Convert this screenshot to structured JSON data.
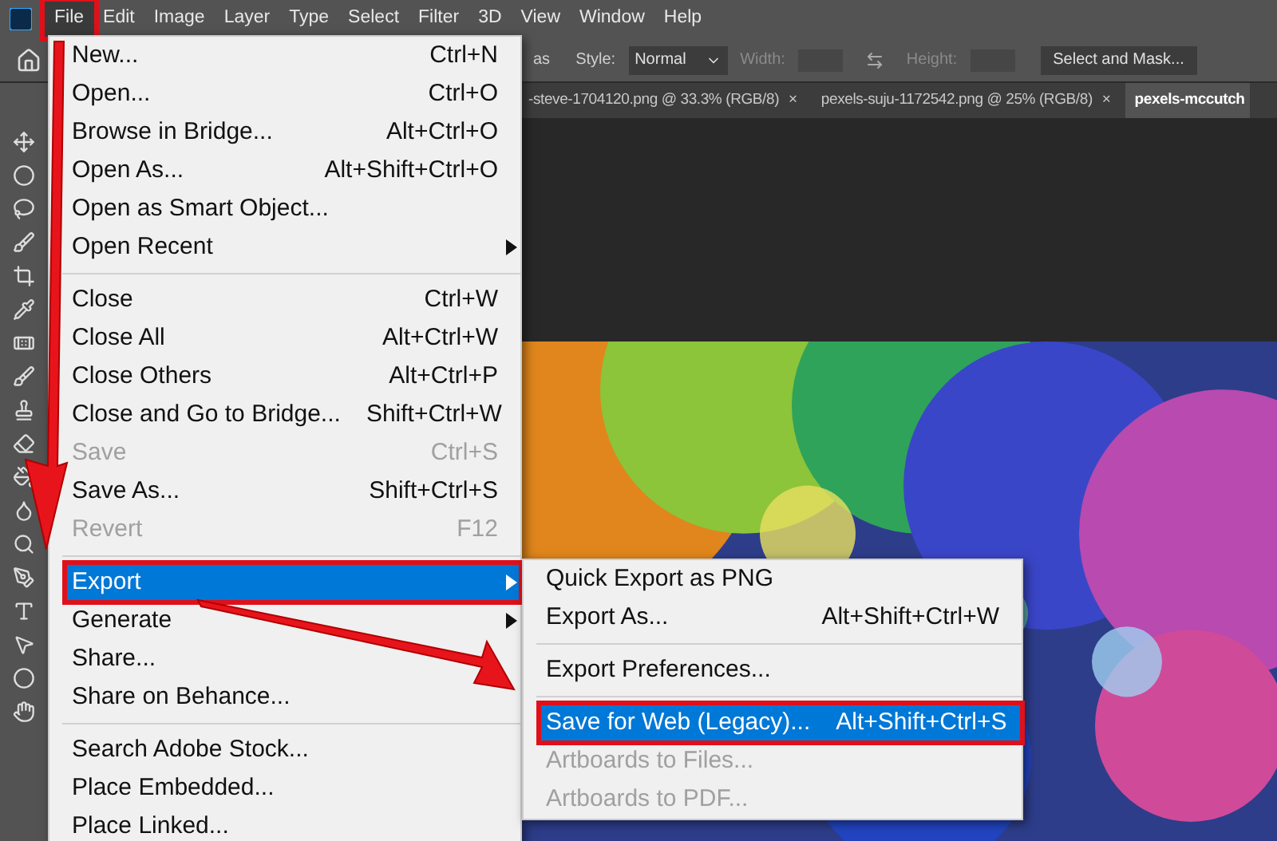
{
  "menubar": [
    {
      "label": "File",
      "selected": true,
      "outlined": true
    },
    {
      "label": "Edit",
      "selected": false,
      "outlined": false
    },
    {
      "label": "Image",
      "selected": false,
      "outlined": false
    },
    {
      "label": "Layer",
      "selected": false,
      "outlined": false
    },
    {
      "label": "Type",
      "selected": false,
      "outlined": false
    },
    {
      "label": "Select",
      "selected": false,
      "outlined": false
    },
    {
      "label": "Filter",
      "selected": false,
      "outlined": false
    },
    {
      "label": "3D",
      "selected": false,
      "outlined": false
    },
    {
      "label": "View",
      "selected": false,
      "outlined": false
    },
    {
      "label": "Window",
      "selected": false,
      "outlined": false
    },
    {
      "label": "Help",
      "selected": false,
      "outlined": false
    }
  ],
  "options_bar": {
    "cut_label": "as",
    "style_label": "Style:",
    "style_value": "Normal",
    "width_label": "Width:",
    "height_label": "Height:",
    "mask_button": "Select and Mask..."
  },
  "document_tabs": [
    {
      "label": "-steve-1704120.png @ 33.3% (RGB/8)",
      "close": "×",
      "selected": false
    },
    {
      "label": "pexels-suju-1172542.png @ 25% (RGB/8)",
      "close": "×",
      "selected": false
    },
    {
      "label": "pexels-mccutch",
      "selected": true
    }
  ],
  "file_menu": [
    [
      {
        "label": "New...",
        "shortcut": "Ctrl+N",
        "disabled": false,
        "submenu": false,
        "selected": false,
        "outlined": false
      },
      {
        "label": "Open...",
        "shortcut": "Ctrl+O",
        "disabled": false,
        "submenu": false,
        "selected": false,
        "outlined": false
      },
      {
        "label": "Browse in Bridge...",
        "shortcut": "Alt+Ctrl+O",
        "disabled": false,
        "submenu": false,
        "selected": false,
        "outlined": false
      },
      {
        "label": "Open As...",
        "shortcut": "Alt+Shift+Ctrl+O",
        "disabled": false,
        "submenu": false,
        "selected": false,
        "outlined": false
      },
      {
        "label": "Open as Smart Object...",
        "disabled": false,
        "submenu": false,
        "selected": false,
        "outlined": false
      },
      {
        "label": "Open Recent",
        "disabled": false,
        "submenu": true,
        "selected": false,
        "outlined": false
      }
    ],
    [
      {
        "label": "Close",
        "shortcut": "Ctrl+W",
        "disabled": false,
        "submenu": false,
        "selected": false,
        "outlined": false
      },
      {
        "label": "Close All",
        "shortcut": "Alt+Ctrl+W",
        "disabled": false,
        "submenu": false,
        "selected": false,
        "outlined": false
      },
      {
        "label": "Close Others",
        "shortcut": "Alt+Ctrl+P",
        "disabled": false,
        "submenu": false,
        "selected": false,
        "outlined": false
      },
      {
        "label": "Close and Go to Bridge...",
        "shortcut": "Shift+Ctrl+W",
        "disabled": false,
        "submenu": false,
        "selected": false,
        "outlined": false
      },
      {
        "label": "Save",
        "shortcut": "Ctrl+S",
        "disabled": true,
        "submenu": false,
        "selected": false,
        "outlined": false
      },
      {
        "label": "Save As...",
        "shortcut": "Shift+Ctrl+S",
        "disabled": false,
        "submenu": false,
        "selected": false,
        "outlined": false
      },
      {
        "label": "Revert",
        "shortcut": "F12",
        "disabled": true,
        "submenu": false,
        "selected": false,
        "outlined": false
      }
    ],
    [
      {
        "label": "Export",
        "disabled": false,
        "submenu": true,
        "selected": true,
        "outlined": true
      },
      {
        "label": "Generate",
        "disabled": false,
        "submenu": true,
        "selected": false,
        "outlined": false
      },
      {
        "label": "Share...",
        "disabled": false,
        "submenu": false,
        "selected": false,
        "outlined": false
      },
      {
        "label": "Share on Behance...",
        "disabled": false,
        "submenu": false,
        "selected": false,
        "outlined": false
      }
    ],
    [
      {
        "label": "Search Adobe Stock...",
        "disabled": false,
        "submenu": false,
        "selected": false,
        "outlined": false
      },
      {
        "label": "Place Embedded...",
        "disabled": false,
        "submenu": false,
        "selected": false,
        "outlined": false
      },
      {
        "label": "Place Linked...",
        "disabled": false,
        "submenu": false,
        "selected": false,
        "outlined": false
      }
    ]
  ],
  "export_menu": [
    [
      {
        "label": "Quick Export as PNG",
        "disabled": false,
        "submenu": false,
        "selected": false,
        "outlined": false
      },
      {
        "label": "Export As...",
        "shortcut": "Alt+Shift+Ctrl+W",
        "disabled": false,
        "submenu": false,
        "selected": false,
        "outlined": false
      }
    ],
    [
      {
        "label": "Export Preferences...",
        "disabled": false,
        "submenu": false,
        "selected": false,
        "outlined": false
      }
    ],
    [
      {
        "label": "Save for Web (Legacy)...",
        "shortcut": "Alt+Shift+Ctrl+S",
        "disabled": false,
        "submenu": false,
        "selected": true,
        "outlined": true
      },
      {
        "label": "Artboards to Files...",
        "disabled": true,
        "submenu": false,
        "selected": false,
        "outlined": false
      },
      {
        "label": "Artboards to PDF...",
        "disabled": true,
        "submenu": false,
        "selected": false,
        "outlined": false
      }
    ]
  ],
  "canvas": {
    "kind": "picture"
  }
}
